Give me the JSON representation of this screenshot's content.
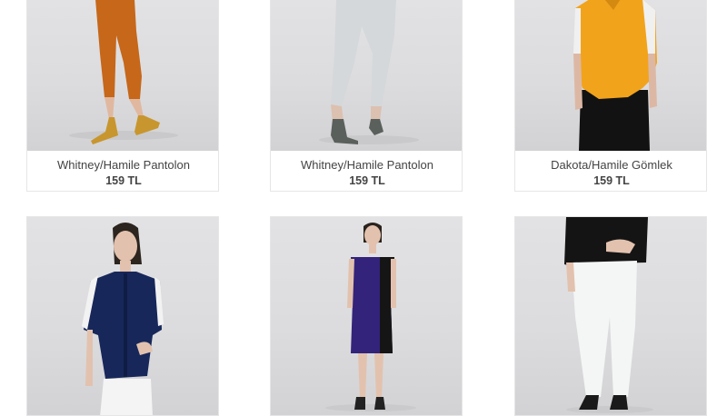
{
  "currency_color": "#444444",
  "products": [
    {
      "name": "Whitney/Hamile Pantolon",
      "price": "159 TL",
      "image": "orange-pants-photo"
    },
    {
      "name": "Whitney/Hamile Pantolon",
      "price": "159 TL",
      "image": "light-grey-pants-photo"
    },
    {
      "name": "Dakota/Hamile Gömlek",
      "price": "159 TL",
      "image": "yellow-shirt-photo"
    },
    {
      "name": "",
      "price": "",
      "image": "navy-shirt-photo"
    },
    {
      "name": "",
      "price": "",
      "image": "purple-dress-photo"
    },
    {
      "name": "",
      "price": "",
      "image": "white-pants-photo"
    }
  ]
}
